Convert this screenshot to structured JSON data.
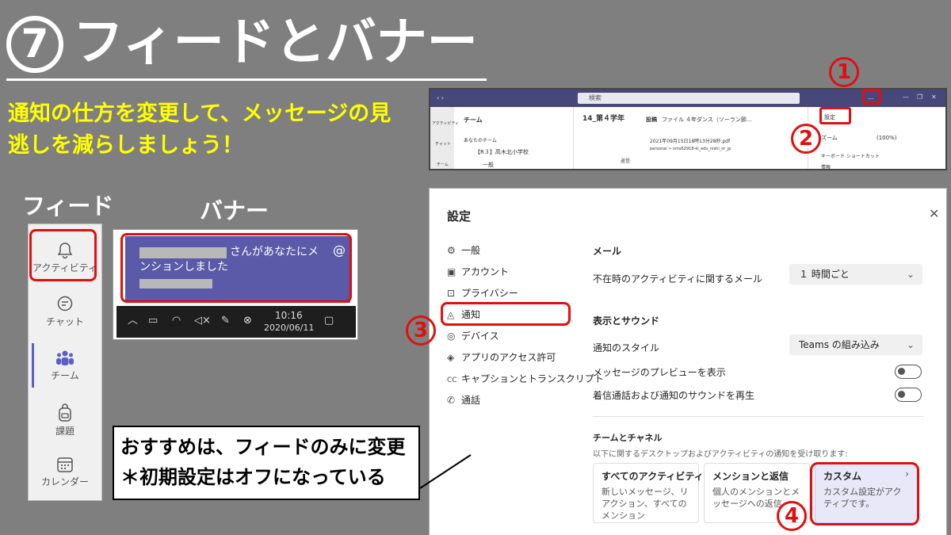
{
  "title": {
    "mark": "7",
    "text": "フィードとバナー"
  },
  "subtitle": "通知の仕方を変更して、メッセージの見逃しを減らしましょう！",
  "labels": {
    "feed": "フィード",
    "banner": "バナー"
  },
  "feed_sidebar": {
    "items": [
      {
        "label": "アクティビティ",
        "icon": "bell-icon"
      },
      {
        "label": "チャット",
        "icon": "chat-icon"
      },
      {
        "label": "チーム",
        "icon": "teams-icon"
      },
      {
        "label": "課題",
        "icon": "backpack-icon"
      },
      {
        "label": "カレンダー",
        "icon": "calendar-icon"
      }
    ]
  },
  "banner": {
    "line1": "さんがあなたにメ",
    "line2": "ンションしました",
    "at_symbol": "@",
    "time": "10:16",
    "date": "2020/06/11"
  },
  "teams_window": {
    "search_placeholder": "検索",
    "more_icon": "…",
    "team_header": "チーム",
    "your_teams": "あなたのチーム",
    "team_name": "【R３】高木北小学校",
    "channel_general": "一般",
    "channel_title": "14_第４学年",
    "tabs": [
      "投稿",
      "ファイル",
      "４年ダンス（ソーラン節..."
    ],
    "file_name": "2021年09月15日18時13分28秒.pdf",
    "file_path": "personal > nms62918-ki_edu_nishi_or_jp",
    "reply": "返信",
    "menu": {
      "settings": "設定",
      "zoom": "ズーム",
      "zoom_value": "(100%)",
      "shortcuts": "キーボード ショートカット",
      "info": "情報"
    },
    "side_icons": [
      "アクティビティ",
      "チャット",
      "チーム"
    ]
  },
  "settings": {
    "title": "設定",
    "nav": [
      {
        "label": "一般",
        "icon": "gear-icon"
      },
      {
        "label": "アカウント",
        "icon": "id-card-icon"
      },
      {
        "label": "プライバシー",
        "icon": "lock-icon"
      },
      {
        "label": "通知",
        "icon": "bell-icon"
      },
      {
        "label": "デバイス",
        "icon": "headset-icon"
      },
      {
        "label": "アプリのアクセス許可",
        "icon": "shield-icon"
      },
      {
        "label": "キャプションとトランスクリプト",
        "icon": "cc-icon"
      },
      {
        "label": "通話",
        "icon": "phone-icon"
      }
    ],
    "email_heading": "メール",
    "email_label": "不在時のアクティビティに関するメール",
    "email_value": "１ 時間ごと",
    "display_heading": "表示とサウンド",
    "style_label": "通知のスタイル",
    "style_value": "Teams の組み込み",
    "preview_label": "メッセージのプレビューを表示",
    "sound_label": "着信通話および通知のサウンドを再生",
    "teams_heading": "チームとチャネル",
    "teams_desc": "以下に関するデスクトップおよびアクティビティの通知を受け取ります:",
    "cards": [
      {
        "title": "すべてのアクティビティ",
        "desc": "新しいメッセージ、リアクション、すべてのメンション"
      },
      {
        "title": "メンションと返信",
        "desc": "個人のメンションとメッセージへの返信"
      },
      {
        "title": "カスタム",
        "desc": "カスタム設定がアクティブです。"
      }
    ]
  },
  "steps": [
    "1",
    "2",
    "3",
    "4"
  ],
  "note": {
    "line1": "おすすめは、フィードのみに変更",
    "line2": "＊初期設定はオフになっている"
  },
  "colors": {
    "highlight": "#e01010",
    "subtitle": "#ffff00",
    "teams_purple": "#5b5fc7"
  }
}
